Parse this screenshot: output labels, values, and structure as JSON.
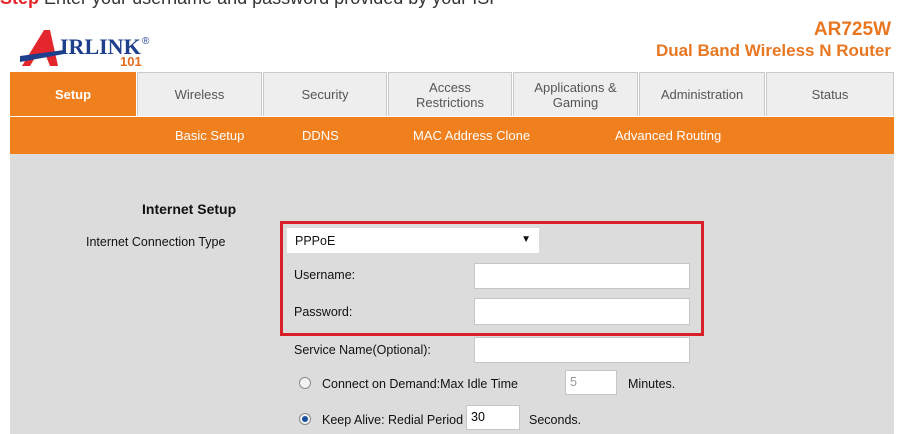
{
  "instruction": {
    "step_label": "Step",
    "text": "Enter your username and password provided by your ISP"
  },
  "brand": {
    "logo_text": "IRLINK",
    "logo_reg": "®",
    "logo_number": "101",
    "model": "AR725W",
    "product_name": "Dual Band Wireless N Router"
  },
  "tabs": [
    {
      "label": "Setup",
      "active": true
    },
    {
      "label": "Wireless",
      "active": false
    },
    {
      "label": "Security",
      "active": false
    },
    {
      "label": "Access\nRestrictions",
      "active": false
    },
    {
      "label": "Applications &\nGaming",
      "active": false
    },
    {
      "label": "Administration",
      "active": false
    },
    {
      "label": "Status",
      "active": false
    }
  ],
  "subnav": [
    "Basic Setup",
    "DDNS",
    "MAC Address Clone",
    "Advanced Routing"
  ],
  "form": {
    "section_title": "Internet Setup",
    "connection_type_label": "Internet Connection Type",
    "connection_type_value": "PPPoE",
    "username_label": "Username:",
    "username_value": "",
    "password_label": "Password:",
    "password_value": "",
    "service_name_label": "Service Name(Optional):",
    "service_name_value": "",
    "connect_on_demand_label": "Connect on Demand:Max Idle Time",
    "max_idle_time_value": "5",
    "minutes_label": "Minutes.",
    "keep_alive_label": "Keep Alive: Redial Period",
    "redial_period_value": "30",
    "seconds_label": "Seconds."
  },
  "colors": {
    "accent_orange": "#f07f1e",
    "highlight_red": "#d81f2a",
    "brand_blue": "#1e3f8c"
  }
}
